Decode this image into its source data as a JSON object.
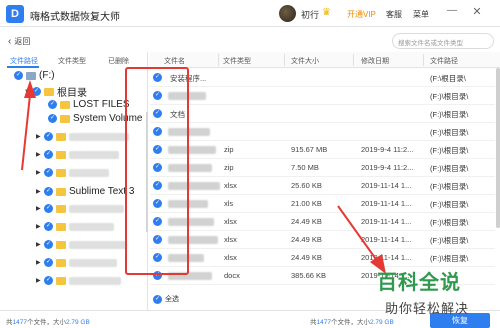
{
  "app": {
    "logo_glyph": "D",
    "title": "嗨格式数据恢复大师"
  },
  "user": {
    "name": "初行",
    "vip_label": "开通VIP"
  },
  "titlebar": {
    "service_label": "客服",
    "menu_label": "菜单",
    "minimize_glyph": "—",
    "close_glyph": "✕"
  },
  "toolbar": {
    "back_label": "返回",
    "search_placeholder": "搜索文件名或文件类型"
  },
  "tabs": {
    "path": "文件路径",
    "type": "文件类型",
    "deleted": "已删除"
  },
  "tree": {
    "drive": "(F:)",
    "root": "根目录",
    "lost_files": "LOST FILES",
    "system_volume": "System Volume I",
    "sublime": "Sublime Text 3"
  },
  "columns": {
    "name": "文件名",
    "type": "文件类型",
    "size": "文件大小",
    "modified": "修改日期",
    "path": "文件路径"
  },
  "rows": [
    {
      "name": "安装程序...",
      "type": "",
      "size": "",
      "date": "",
      "path": "(F:\\根目录\\"
    },
    {
      "name": "",
      "type": "",
      "size": "",
      "date": "",
      "path": "(F:)\\根目录\\"
    },
    {
      "name": "文档",
      "type": "",
      "size": "",
      "date": "",
      "path": "(F:)\\根目录\\"
    },
    {
      "name": "",
      "type": "",
      "size": "",
      "date": "",
      "path": "(F:)\\根目录\\"
    },
    {
      "name": "",
      "type": "zip",
      "size": "915.67 MB",
      "date": "2019-9-4 11:2...",
      "path": "(F:)\\根目录\\"
    },
    {
      "name": "",
      "type": "zip",
      "size": "7.50 MB",
      "date": "2019-9-4 11:2...",
      "path": "(F:)\\根目录\\"
    },
    {
      "name": "",
      "type": "xlsx",
      "size": "25.60 KB",
      "date": "2019-11-14 1...",
      "path": "(F:)\\根目录\\"
    },
    {
      "name": "",
      "type": "xls",
      "size": "21.00 KB",
      "date": "2019-11-14 1...",
      "path": "(F:)\\根目录\\"
    },
    {
      "name": "",
      "type": "xlsx",
      "size": "24.49 KB",
      "date": "2019-11-14 1...",
      "path": "(F:)\\根目录\\"
    },
    {
      "name": "",
      "type": "xlsx",
      "size": "24.49 KB",
      "date": "2019-11-14 1...",
      "path": "(F:)\\根目录\\"
    },
    {
      "name": "",
      "type": "xlsx",
      "size": "24.49 KB",
      "date": "2019-11-14 1...",
      "path": "(F:)\\根目录\\"
    },
    {
      "name": "",
      "type": "docx",
      "size": "385.66 KB",
      "date": "2019-11-14 1...",
      "path": ""
    }
  ],
  "footer": {
    "select_all": "全选",
    "left_status_prefix": "共",
    "left_count": "1477",
    "left_status_mid": "个文件，大小",
    "left_size": "2.79 GB",
    "right_status_prefix": "共",
    "right_count": "1477",
    "right_status_mid": "个文件，大小",
    "right_size": "2.79 GB",
    "recover_label": "恢复"
  },
  "watermark": {
    "main": "百科全说",
    "sub": "助你轻松解决"
  },
  "colors": {
    "accent": "#2f7ef0",
    "annotation": "#e53935",
    "watermark": "#2f9a4e"
  }
}
